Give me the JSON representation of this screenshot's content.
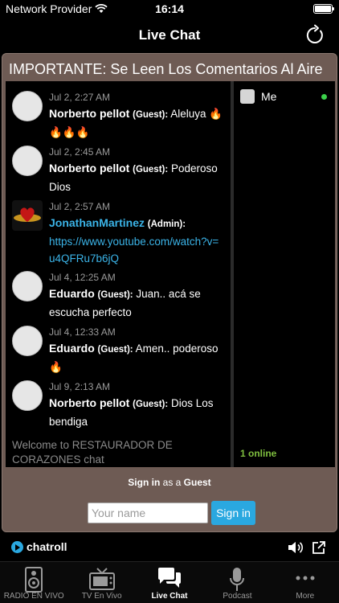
{
  "status": {
    "carrier": "Network Provider",
    "time": "16:14"
  },
  "nav": {
    "title": "Live Chat"
  },
  "chat": {
    "header": "IMPORTANTE: Se Leen Los Comentarios Al Aire",
    "messages": [
      {
        "time": "Jul 2, 2:27 AM",
        "author": "Norberto pellot",
        "role": "(Guest):",
        "text": "Aleluya 🔥🔥🔥🔥"
      },
      {
        "time": "Jul 2, 2:45 AM",
        "author": "Norberto pellot",
        "role": "(Guest):",
        "text": "Poderoso Dios"
      },
      {
        "time": "Jul 2, 2:57 AM",
        "author": "JonathanMartinez",
        "role": "(Admin):",
        "text": "https://www.youtube.com/watch?v=u4QFRu7b6jQ"
      },
      {
        "time": "Jul 4, 12:25 AM",
        "author": "Eduardo",
        "role": "(Guest):",
        "text": "Juan.. acá se escucha perfecto"
      },
      {
        "time": "Jul 4, 12:33 AM",
        "author": "Eduardo",
        "role": "(Guest):",
        "text": "Amen.. poderoso 🔥"
      },
      {
        "time": "Jul 9, 2:13 AM",
        "author": "Norberto pellot",
        "role": "(Guest):",
        "text": "Dios Los bendiga"
      }
    ],
    "welcome": "Welcome to RESTAURADOR DE CORAZONES chat",
    "users": {
      "me": "Me",
      "online": "1 online"
    },
    "signin": {
      "prefix": "Sign in",
      "middle": "as a",
      "suffix": "Guest",
      "placeholder": "Your name",
      "button": "Sign in"
    }
  },
  "chatroll": {
    "brand": "chatroll"
  },
  "tabs": [
    {
      "label": "RADIO EN VIVO",
      "icon": "speaker-icon",
      "active": false
    },
    {
      "label": "TV En Vivo",
      "icon": "tv-icon",
      "active": false
    },
    {
      "label": "Live Chat",
      "icon": "chat-bubbles-icon",
      "active": true
    },
    {
      "label": "Podcast",
      "icon": "microphone-icon",
      "active": false
    },
    {
      "label": "More",
      "icon": "more-dots-icon",
      "active": false
    }
  ],
  "colors": {
    "frame": "#6e5b54",
    "accent": "#2aa8e0",
    "online": "#3bd04a"
  }
}
